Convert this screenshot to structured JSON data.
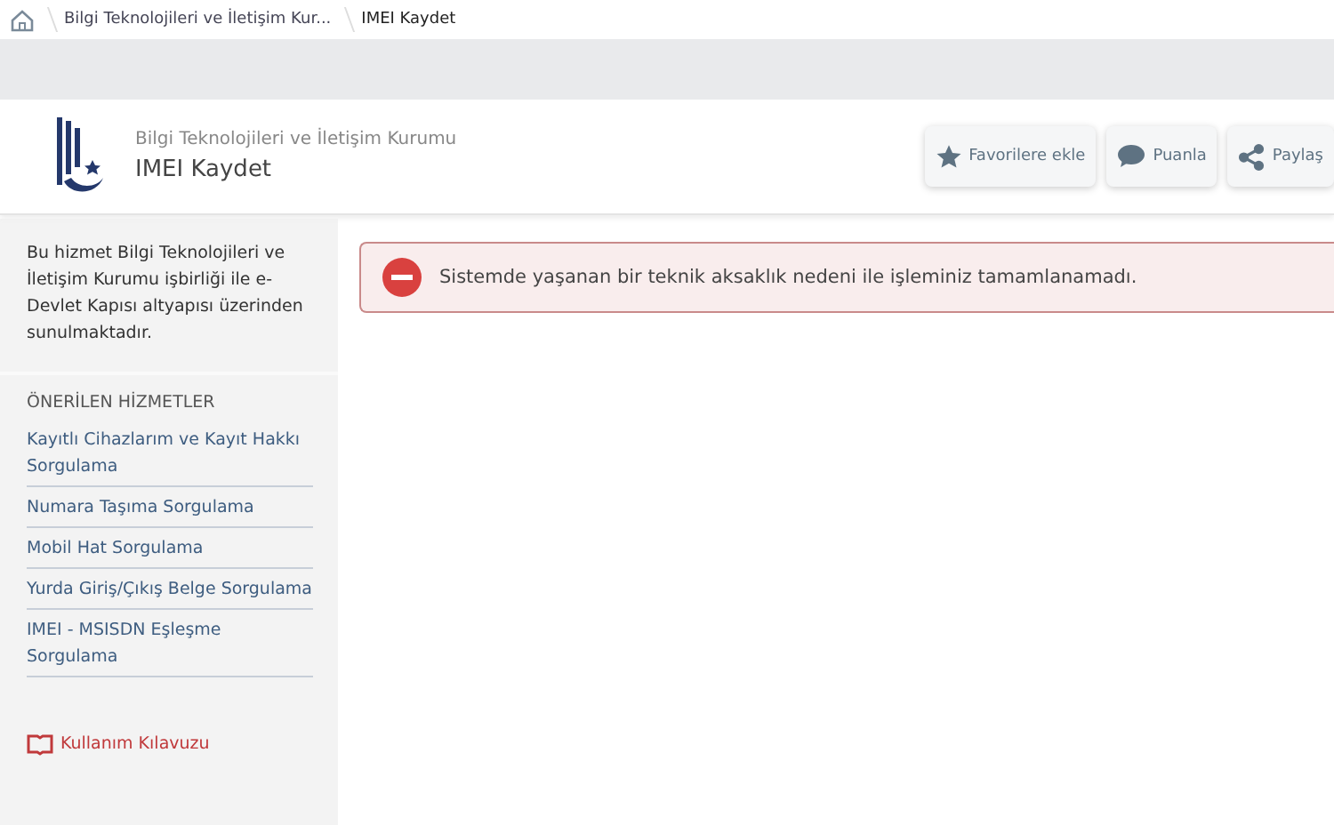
{
  "breadcrumb": [
    {
      "kind": "home"
    },
    {
      "kind": "link",
      "label": "Bilgi Teknolojileri ve İletişim Kur..."
    },
    {
      "kind": "current",
      "label": "IMEI Kaydet"
    }
  ],
  "header": {
    "organization": "Bilgi Teknolojileri ve İletişim Kurumu",
    "title": "IMEI Kaydet",
    "actions": [
      {
        "kind": "star",
        "label": "Favorilere ekle"
      },
      {
        "kind": "comment",
        "label": "Puanla"
      },
      {
        "kind": "share",
        "label": "Paylaş"
      }
    ]
  },
  "sidebar": {
    "info": "Bu hizmet Bilgi Teknolojileri ve İletişim Kurumu işbirliği ile e-Devlet Kapısı altyapısı üzerinden sunulmaktadır.",
    "section_title": "ÖNERİLEN HİZMETLER",
    "services": [
      "Kayıtlı Cihazlarım ve Kayıt Hakkı Sorgulama",
      "Numara Taşıma Sorgulama",
      "Mobil Hat Sorgulama",
      "Yurda Giriş/Çıkış Belge Sorgulama",
      "IMEI - MSISDN Eşleşme Sorgulama"
    ],
    "guide_link": "Kullanım Kılavuzu"
  },
  "alert": {
    "kind": "error",
    "message": "Sistemde yaşanan bir teknik aksaklık nedeni ile işleminiz tamamlanamadı."
  }
}
